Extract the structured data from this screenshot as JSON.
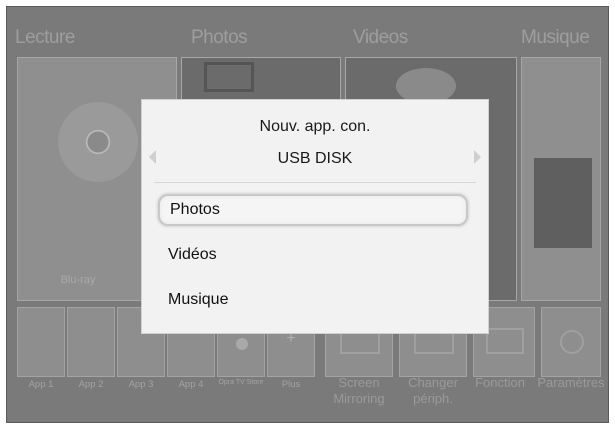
{
  "categories": [
    "Lecture",
    "Photos",
    "Videos",
    "Musique"
  ],
  "tiles": {
    "lecture_label": "Blu-ray"
  },
  "apps": [
    {
      "label": "App 1"
    },
    {
      "label": "App 2"
    },
    {
      "label": "App 3"
    },
    {
      "label": "App 4"
    },
    {
      "label": "Opra TV Store"
    },
    {
      "label": "Plus"
    }
  ],
  "functions": [
    {
      "label": "Screen Mirroring"
    },
    {
      "label": "Changer périph."
    },
    {
      "label": "Fonction"
    },
    {
      "label": "Paramètres"
    }
  ],
  "dialog": {
    "title": "Nouv. app. con.",
    "device": "USB DISK",
    "items": [
      {
        "label": "Photos",
        "selected": true
      },
      {
        "label": "Vidéos",
        "selected": false
      },
      {
        "label": "Musique",
        "selected": false
      }
    ]
  },
  "colors": {
    "background": "#7a7a7a",
    "dialog": "#f2f2f2",
    "highlight": "#c8c8c8"
  }
}
